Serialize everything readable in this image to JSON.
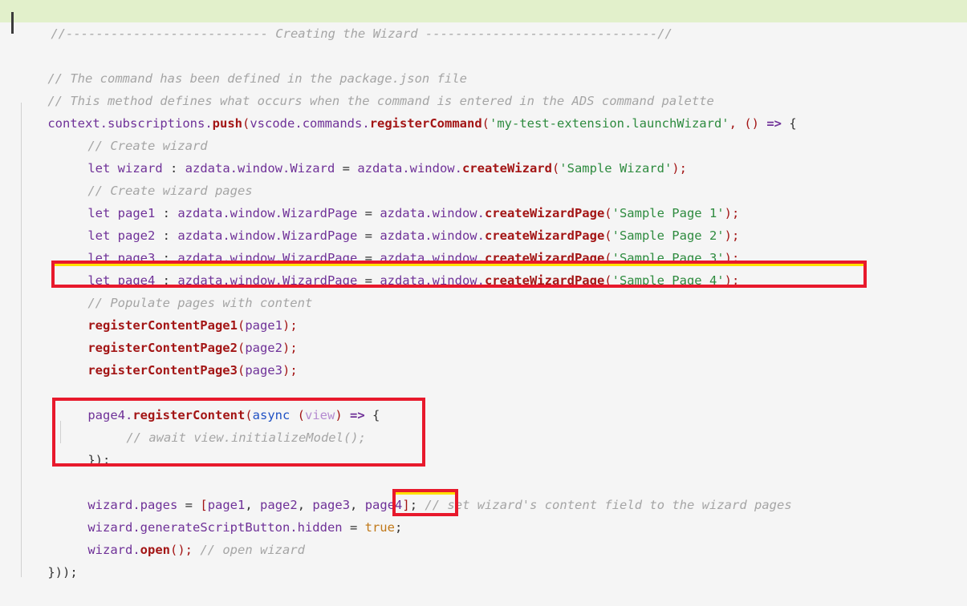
{
  "editor": {
    "language": "typescript",
    "background_color": "#f5f5f5",
    "highlight_band_color": "#e2f0cb",
    "annotation_color": "#e8192c",
    "annotation_inner_color": "#ffe000",
    "cursor_color": "#3b3b3b"
  },
  "code": {
    "line01": {
      "banner_comment": "//--------------------------- Creating the Wizard -------------------------------//"
    },
    "line02": {
      "text": ""
    },
    "line03": {
      "comment": "// The command has been defined in the package.json file"
    },
    "line04": {
      "comment": "// This method defines what occurs when the command is entered in the ADS command palette"
    },
    "line05": {
      "id1": "context",
      "dot1": ".",
      "id2": "subscriptions",
      "dot2": ".",
      "fn1": "push",
      "open1": "(",
      "id3": "vscode",
      "dot3": ".",
      "id4": "commands",
      "dot4": ".",
      "fn2": "registerCommand",
      "open2": "(",
      "string": "'my-test-extension.launchWizard'",
      "comma": ", ",
      "parens": "()",
      "arrow": " => ",
      "brace": "{"
    },
    "line06": {
      "comment": "// Create wizard"
    },
    "line07": {
      "kw": "let",
      "name": "wizard",
      "colon": " : ",
      "type": "azdata.window.Wizard",
      "eq": " = ",
      "ns": "azdata.window.",
      "fn": "createWizard",
      "open": "(",
      "string": "'Sample Wizard'",
      "close": ");"
    },
    "line08": {
      "comment": "// Create wizard pages"
    },
    "line09": {
      "kw": "let",
      "name": "page1",
      "colon": " : ",
      "type": "azdata.window.WizardPage",
      "eq": " = ",
      "ns": "azdata.window.",
      "fn": "createWizardPage",
      "open": "(",
      "string": "'Sample Page 1'",
      "close": ");"
    },
    "line10": {
      "kw": "let",
      "name": "page2",
      "colon": " : ",
      "type": "azdata.window.WizardPage",
      "eq": " = ",
      "ns": "azdata.window.",
      "fn": "createWizardPage",
      "open": "(",
      "string": "'Sample Page 2'",
      "close": ");"
    },
    "line11": {
      "kw": "let",
      "name": "page3",
      "colon": " : ",
      "type": "azdata.window.WizardPage",
      "eq": " = ",
      "ns": "azdata.window.",
      "fn": "createWizardPage",
      "open": "(",
      "string": "'Sample Page 3'",
      "close": ");"
    },
    "line12": {
      "kw": "let",
      "name": "page4",
      "colon": " : ",
      "type": "azdata.window.WizardPage",
      "eq": " = ",
      "ns": "azdata.window.",
      "fn": "createWizardPage",
      "open": "(",
      "string": "'Sample Page 4'",
      "close": ");",
      "annotated": "true"
    },
    "line13": {
      "comment": "// Populate pages with content"
    },
    "line14": {
      "fn": "registerContentPage1",
      "open": "(",
      "arg": "page1",
      "close": ");"
    },
    "line15": {
      "fn": "registerContentPage2",
      "open": "(",
      "arg": "page2",
      "close": ");"
    },
    "line16": {
      "fn": "registerContentPage3",
      "open": "(",
      "arg": "page3",
      "close": ");"
    },
    "line17": {
      "text": ""
    },
    "line18": {
      "obj": "page4",
      "dot": ".",
      "fn": "registerContent",
      "open": "(",
      "async": "async",
      "paramopen": " (",
      "param": "view",
      "paramclose": ")",
      "arrow": " => ",
      "brace": "{",
      "annotated": "true"
    },
    "line19": {
      "comment": "// await view.initializeModel();"
    },
    "line20": {
      "close": "});"
    },
    "line21": {
      "text": ""
    },
    "line22": {
      "obj": "wizard",
      "dot": ".",
      "prop": "pages",
      "eq": " = ",
      "bracketopen": "[",
      "arg1": "page1",
      "sep1": ", ",
      "arg2": "page2",
      "sep2": ", ",
      "arg3": "page3",
      "sep3": ", ",
      "arg4": "page4",
      "bracketclose": "]",
      "semi": "; ",
      "comment": "// set wizard's content field to the wizard pages",
      "annotated": "true"
    },
    "line23": {
      "obj": "wizard",
      "dot": ".",
      "prop": "generateScriptButton.hidden",
      "eq": " = ",
      "bool": "true",
      "semi": ";"
    },
    "line24": {
      "obj": "wizard",
      "dot": ".",
      "fn": "open",
      "call": "(); ",
      "comment": "// open wizard"
    },
    "line25": {
      "close": "}));"
    }
  },
  "annotations": [
    {
      "name": "page4-declaration-box",
      "target": "line12"
    },
    {
      "name": "page4-register-content-box",
      "target": "line18-20"
    },
    {
      "name": "page4-array-entry-box",
      "target": "line22-page4"
    }
  ]
}
